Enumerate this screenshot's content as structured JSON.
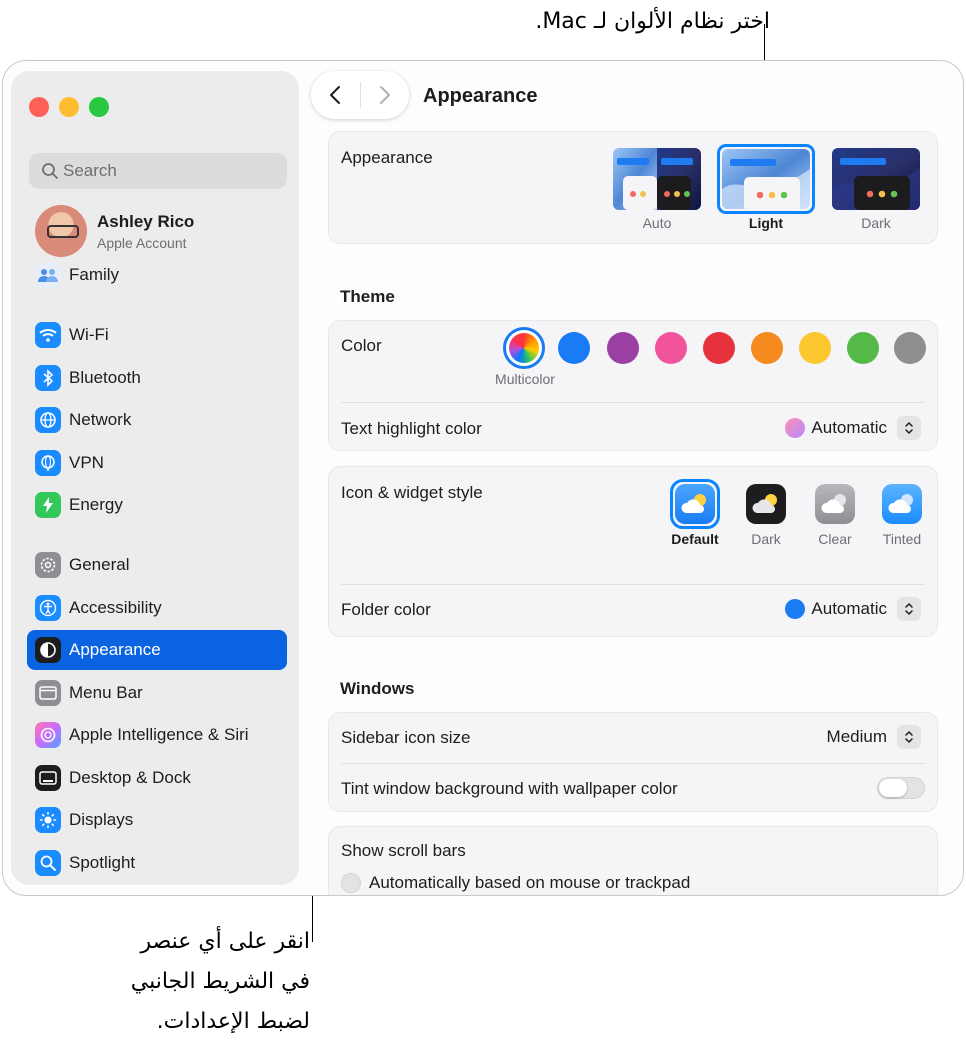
{
  "callouts": {
    "top": "اختر نظام الألوان لـ Mac.",
    "bottom_lines": [
      "انقر على أي عنصر",
      "في الشريط الجانبي",
      "لضبط الإعدادات."
    ]
  },
  "sidebar": {
    "search_placeholder": "Search",
    "account": {
      "name": "Ashley Rico",
      "subtitle": "Apple Account"
    },
    "family": "Family",
    "items": [
      {
        "label": "Wi-Fi",
        "icon": "wifi-icon",
        "color": "#1a8cff"
      },
      {
        "label": "Bluetooth",
        "icon": "bluetooth-icon",
        "color": "#1a8cff"
      },
      {
        "label": "Network",
        "icon": "globe-icon",
        "color": "#1a8cff"
      },
      {
        "label": "VPN",
        "icon": "vpn-globe-icon",
        "color": "#1a8cff"
      },
      {
        "label": "Energy",
        "icon": "bolt-icon",
        "color": "#34c759"
      },
      {
        "label": "General",
        "icon": "gear-icon",
        "color": "#8e8e93"
      },
      {
        "label": "Accessibility",
        "icon": "accessibility-icon",
        "color": "#1a8cff"
      },
      {
        "label": "Appearance",
        "icon": "appearance-icon",
        "color": "#1d1d1f"
      },
      {
        "label": "Menu Bar",
        "icon": "menubar-icon",
        "color": "#8e8e93"
      },
      {
        "label": "Apple Intelligence & Siri",
        "icon": "siri-icon",
        "color": "#c86bff"
      },
      {
        "label": "Desktop & Dock",
        "icon": "dock-icon",
        "color": "#1d1d1f"
      },
      {
        "label": "Displays",
        "icon": "sun-icon",
        "color": "#1a8cff"
      },
      {
        "label": "Spotlight",
        "icon": "spotlight-icon",
        "color": "#1a8cff"
      }
    ],
    "selected": "Appearance"
  },
  "toolbar": {
    "title": "Appearance"
  },
  "appearance": {
    "label": "Appearance",
    "options": [
      "Auto",
      "Light",
      "Dark"
    ],
    "selected": "Light"
  },
  "theme": {
    "section_title": "Theme",
    "color_label": "Color",
    "multicolor_label": "Multicolor",
    "colors": [
      "#1a7cf5",
      "#9b3fa3",
      "#f2549b",
      "#e5323c",
      "#f58b1f",
      "#fdc82f",
      "#55b948",
      "#8e8e8e"
    ],
    "text_highlight_label": "Text highlight color",
    "text_highlight_value": "Automatic",
    "icon_style_label": "Icon & widget style",
    "icon_styles": [
      "Default",
      "Dark",
      "Clear",
      "Tinted"
    ],
    "icon_style_selected": "Default",
    "folder_color_label": "Folder color",
    "folder_color_value": "Automatic"
  },
  "windows": {
    "section_title": "Windows",
    "sidebar_icon_size_label": "Sidebar icon size",
    "sidebar_icon_size_value": "Medium",
    "tint_label": "Tint window background with wallpaper color",
    "tint_on": false,
    "scroll_label": "Show scroll bars",
    "scroll_option": "Automatically based on mouse or trackpad"
  }
}
